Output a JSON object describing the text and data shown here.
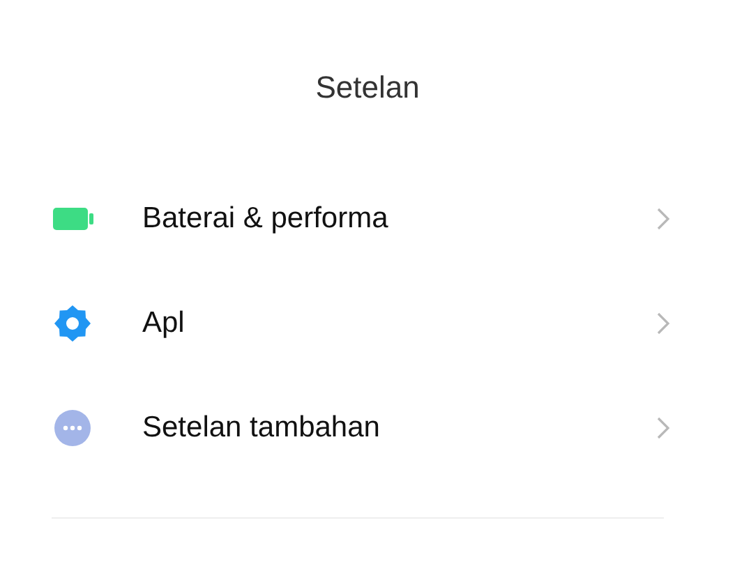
{
  "title": "Setelan",
  "items": [
    {
      "kind": "battery",
      "label": "Baterai & performa"
    },
    {
      "kind": "gear",
      "label": "Apl"
    },
    {
      "kind": "more",
      "label": "Setelan tambahan"
    }
  ]
}
